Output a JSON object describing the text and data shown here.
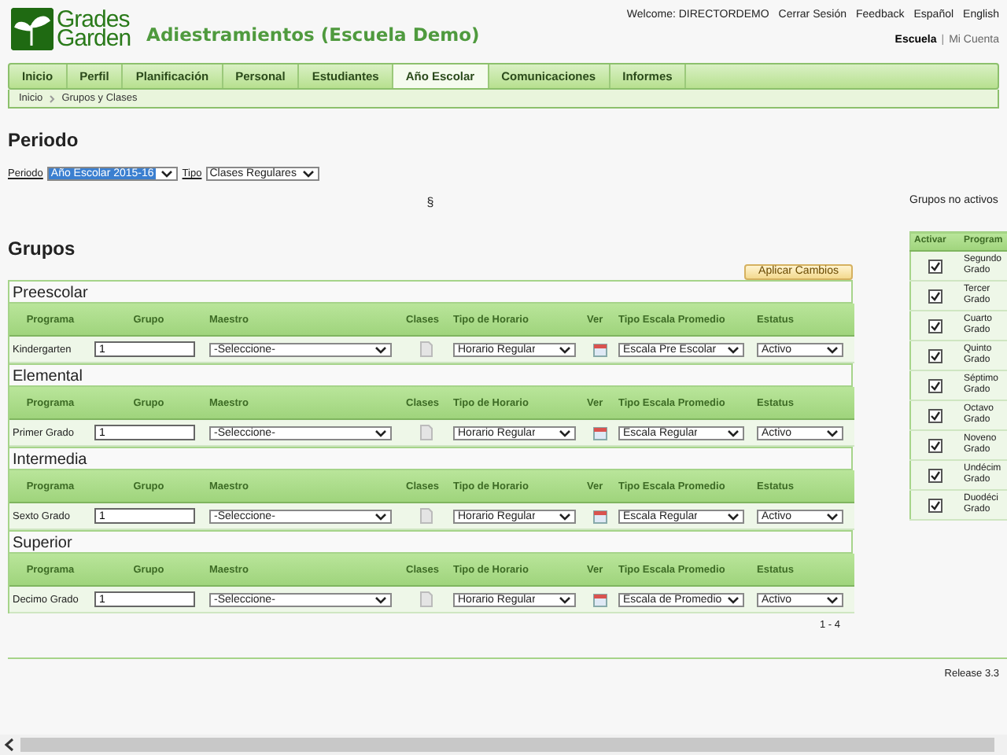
{
  "header": {
    "logo": [
      "Grades",
      "Garden"
    ],
    "title": "Adiestramientos (Escuela Demo)",
    "top_links": [
      "Welcome: DIRECTORDEMO",
      "Cerrar Sesión",
      "Feedback",
      "Español",
      "English"
    ],
    "account_separator": "|",
    "account_links": [
      {
        "label": "Escuela",
        "selected": true
      },
      {
        "label": "Mi Cuenta",
        "selected": false
      }
    ]
  },
  "nav": [
    {
      "label": "Inicio",
      "selected": false
    },
    {
      "label": "Perfil",
      "selected": false
    },
    {
      "label": "Planificación",
      "selected": false
    },
    {
      "label": "Personal",
      "selected": false
    },
    {
      "label": "Estudiantes",
      "selected": false
    },
    {
      "label": "Año Escolar",
      "selected": true
    },
    {
      "label": "Comunicaciones",
      "selected": false
    },
    {
      "label": "Informes",
      "selected": false
    }
  ],
  "breadcrumb": [
    "Inicio",
    "Grupos y Clases"
  ],
  "periodo": {
    "heading": "Periodo",
    "filters": [
      {
        "label": "Periodo",
        "value": "Año Escolar 2015-16",
        "highlighted": true
      },
      {
        "label": "Tipo",
        "value": "Clases Regulares",
        "highlighted": false
      }
    ],
    "mark": "§"
  },
  "grupos": {
    "heading": "Grupos",
    "apply_button": "Aplicar Cambios",
    "sections": [
      {
        "title": "Preescolar",
        "columns": [
          "Programa",
          "Grupo",
          "Maestro",
          "Clases",
          "Tipo de Horario",
          "Ver",
          "Tipo Escala Promedio",
          "Estatus"
        ],
        "rows": [
          {
            "program": "Kindergarten",
            "group": "1",
            "teacher": "-Seleccione-",
            "schedule": "Horario Regular",
            "scale": "Escala Pre Escolar",
            "status": "Activo"
          }
        ]
      },
      {
        "title": "Elemental",
        "columns": [
          "Programa",
          "Grupo",
          "Maestro",
          "Clases",
          "Tipo de Horario",
          "Ver",
          "Tipo Escala Promedio",
          "Estatus"
        ],
        "rows": [
          {
            "program": "Primer Grado",
            "group": "1",
            "teacher": "-Seleccione-",
            "schedule": "Horario Regular",
            "scale": "Escala Regular",
            "status": "Activo"
          }
        ]
      },
      {
        "title": "Intermedia",
        "columns": [
          "Programa",
          "Grupo",
          "Maestro",
          "Clases",
          "Tipo de Horario",
          "Ver",
          "Tipo Escala Promedio",
          "Estatus"
        ],
        "rows": [
          {
            "program": "Sexto Grado",
            "group": "1",
            "teacher": "-Seleccione-",
            "schedule": "Horario Regular",
            "scale": "Escala Regular",
            "status": "Activo"
          }
        ]
      },
      {
        "title": "Superior",
        "columns": [
          "Programa",
          "Grupo",
          "Maestro",
          "Clases",
          "Tipo de Horario",
          "Ver",
          "Tipo Escala Promedio",
          "Estatus"
        ],
        "rows": [
          {
            "program": "Decimo Grado",
            "group": "1",
            "teacher": "-Seleccione-",
            "schedule": "Horario Regular",
            "scale": "Escala de Promedio",
            "status": "Activo"
          }
        ]
      }
    ],
    "pager": "1 - 4"
  },
  "inactive": {
    "title": "Grupos no activos",
    "columns": [
      "Activar",
      "Program"
    ],
    "rows": [
      {
        "checked": true,
        "program": "Segundo Grado"
      },
      {
        "checked": true,
        "program": "Tercer Grado"
      },
      {
        "checked": true,
        "program": "Cuarto Grado"
      },
      {
        "checked": true,
        "program": "Quinto Grado"
      },
      {
        "checked": true,
        "program": "Séptimo Grado"
      },
      {
        "checked": true,
        "program": "Octavo Grado"
      },
      {
        "checked": true,
        "program": "Noveno Grado"
      },
      {
        "checked": true,
        "program": "Undécim Grado"
      },
      {
        "checked": true,
        "program": "Duodéci Grado"
      }
    ]
  },
  "footer": {
    "release": "Release 3.3"
  }
}
